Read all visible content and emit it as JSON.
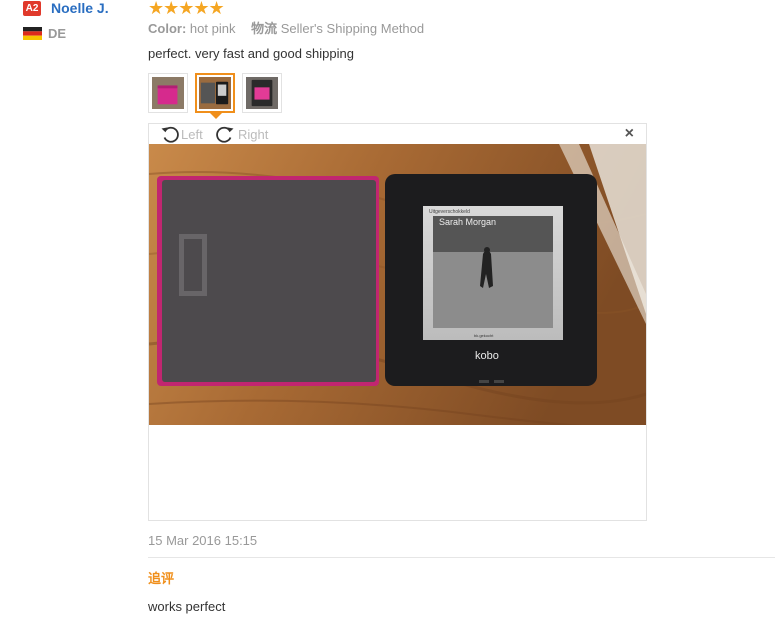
{
  "reviewer": {
    "level_badge": "A2",
    "name": "Noelle J.",
    "country": "DE"
  },
  "review": {
    "stars": "★★★★★",
    "color_label": "Color:",
    "color_value": "hot pink",
    "shipping_label": "物流",
    "shipping_value": "Seller's Shipping Method",
    "text": "perfect. very fast and good shipping",
    "date": "15 Mar 2016 15:15"
  },
  "thumbnails": [
    {
      "icon": "pink-cover-photo",
      "selected": false
    },
    {
      "icon": "kobo-reader-photo",
      "selected": true
    },
    {
      "icon": "pink-case-photo",
      "selected": false
    }
  ],
  "viewer": {
    "rotate_left_label": "Left",
    "rotate_right_label": "Right",
    "close_glyph": "×",
    "photo": {
      "device_brand": "kobo",
      "screen_header": "Uitgeverschokkeld",
      "book_author": "Sarah Morgan",
      "screen_footer": "bk.gekocht"
    }
  },
  "followup": {
    "label": "追评",
    "text": "works perfect"
  },
  "colors": {
    "accent_orange": "#f08f1b",
    "name_blue": "#2a6ec1",
    "badge_red": "#e0392b",
    "star_gold": "#f5a623"
  }
}
